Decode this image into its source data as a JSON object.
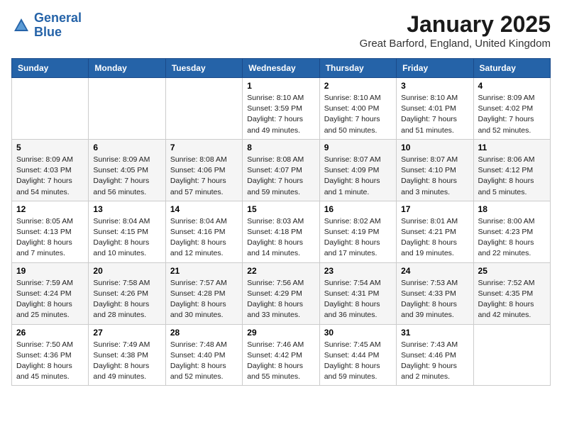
{
  "header": {
    "logo_line1": "General",
    "logo_line2": "Blue",
    "month_title": "January 2025",
    "location": "Great Barford, England, United Kingdom"
  },
  "weekdays": [
    "Sunday",
    "Monday",
    "Tuesday",
    "Wednesday",
    "Thursday",
    "Friday",
    "Saturday"
  ],
  "weeks": [
    [
      {
        "day": "",
        "info": ""
      },
      {
        "day": "",
        "info": ""
      },
      {
        "day": "",
        "info": ""
      },
      {
        "day": "1",
        "info": "Sunrise: 8:10 AM\nSunset: 3:59 PM\nDaylight: 7 hours\nand 49 minutes."
      },
      {
        "day": "2",
        "info": "Sunrise: 8:10 AM\nSunset: 4:00 PM\nDaylight: 7 hours\nand 50 minutes."
      },
      {
        "day": "3",
        "info": "Sunrise: 8:10 AM\nSunset: 4:01 PM\nDaylight: 7 hours\nand 51 minutes."
      },
      {
        "day": "4",
        "info": "Sunrise: 8:09 AM\nSunset: 4:02 PM\nDaylight: 7 hours\nand 52 minutes."
      }
    ],
    [
      {
        "day": "5",
        "info": "Sunrise: 8:09 AM\nSunset: 4:03 PM\nDaylight: 7 hours\nand 54 minutes."
      },
      {
        "day": "6",
        "info": "Sunrise: 8:09 AM\nSunset: 4:05 PM\nDaylight: 7 hours\nand 56 minutes."
      },
      {
        "day": "7",
        "info": "Sunrise: 8:08 AM\nSunset: 4:06 PM\nDaylight: 7 hours\nand 57 minutes."
      },
      {
        "day": "8",
        "info": "Sunrise: 8:08 AM\nSunset: 4:07 PM\nDaylight: 7 hours\nand 59 minutes."
      },
      {
        "day": "9",
        "info": "Sunrise: 8:07 AM\nSunset: 4:09 PM\nDaylight: 8 hours\nand 1 minute."
      },
      {
        "day": "10",
        "info": "Sunrise: 8:07 AM\nSunset: 4:10 PM\nDaylight: 8 hours\nand 3 minutes."
      },
      {
        "day": "11",
        "info": "Sunrise: 8:06 AM\nSunset: 4:12 PM\nDaylight: 8 hours\nand 5 minutes."
      }
    ],
    [
      {
        "day": "12",
        "info": "Sunrise: 8:05 AM\nSunset: 4:13 PM\nDaylight: 8 hours\nand 7 minutes."
      },
      {
        "day": "13",
        "info": "Sunrise: 8:04 AM\nSunset: 4:15 PM\nDaylight: 8 hours\nand 10 minutes."
      },
      {
        "day": "14",
        "info": "Sunrise: 8:04 AM\nSunset: 4:16 PM\nDaylight: 8 hours\nand 12 minutes."
      },
      {
        "day": "15",
        "info": "Sunrise: 8:03 AM\nSunset: 4:18 PM\nDaylight: 8 hours\nand 14 minutes."
      },
      {
        "day": "16",
        "info": "Sunrise: 8:02 AM\nSunset: 4:19 PM\nDaylight: 8 hours\nand 17 minutes."
      },
      {
        "day": "17",
        "info": "Sunrise: 8:01 AM\nSunset: 4:21 PM\nDaylight: 8 hours\nand 19 minutes."
      },
      {
        "day": "18",
        "info": "Sunrise: 8:00 AM\nSunset: 4:23 PM\nDaylight: 8 hours\nand 22 minutes."
      }
    ],
    [
      {
        "day": "19",
        "info": "Sunrise: 7:59 AM\nSunset: 4:24 PM\nDaylight: 8 hours\nand 25 minutes."
      },
      {
        "day": "20",
        "info": "Sunrise: 7:58 AM\nSunset: 4:26 PM\nDaylight: 8 hours\nand 28 minutes."
      },
      {
        "day": "21",
        "info": "Sunrise: 7:57 AM\nSunset: 4:28 PM\nDaylight: 8 hours\nand 30 minutes."
      },
      {
        "day": "22",
        "info": "Sunrise: 7:56 AM\nSunset: 4:29 PM\nDaylight: 8 hours\nand 33 minutes."
      },
      {
        "day": "23",
        "info": "Sunrise: 7:54 AM\nSunset: 4:31 PM\nDaylight: 8 hours\nand 36 minutes."
      },
      {
        "day": "24",
        "info": "Sunrise: 7:53 AM\nSunset: 4:33 PM\nDaylight: 8 hours\nand 39 minutes."
      },
      {
        "day": "25",
        "info": "Sunrise: 7:52 AM\nSunset: 4:35 PM\nDaylight: 8 hours\nand 42 minutes."
      }
    ],
    [
      {
        "day": "26",
        "info": "Sunrise: 7:50 AM\nSunset: 4:36 PM\nDaylight: 8 hours\nand 45 minutes."
      },
      {
        "day": "27",
        "info": "Sunrise: 7:49 AM\nSunset: 4:38 PM\nDaylight: 8 hours\nand 49 minutes."
      },
      {
        "day": "28",
        "info": "Sunrise: 7:48 AM\nSunset: 4:40 PM\nDaylight: 8 hours\nand 52 minutes."
      },
      {
        "day": "29",
        "info": "Sunrise: 7:46 AM\nSunset: 4:42 PM\nDaylight: 8 hours\nand 55 minutes."
      },
      {
        "day": "30",
        "info": "Sunrise: 7:45 AM\nSunset: 4:44 PM\nDaylight: 8 hours\nand 59 minutes."
      },
      {
        "day": "31",
        "info": "Sunrise: 7:43 AM\nSunset: 4:46 PM\nDaylight: 9 hours\nand 2 minutes."
      },
      {
        "day": "",
        "info": ""
      }
    ]
  ]
}
